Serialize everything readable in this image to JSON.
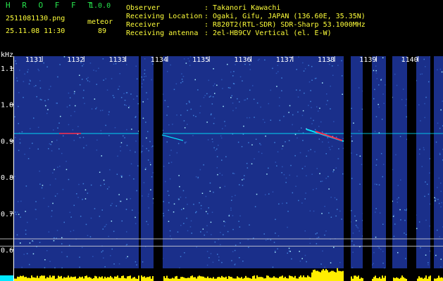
{
  "header": {
    "app_name": "H R O F F T",
    "version": "1.0.0",
    "file_name": "2511081130.png",
    "mode": "meteor",
    "datetime": "25.11.08 11:30",
    "count": "89",
    "fields": [
      {
        "label": "Observer",
        "value": ": Takanori Kawachi"
      },
      {
        "label": "Receiving Location",
        "value": ": Ogaki, Gifu, JAPAN (136.60E, 35.35N)"
      },
      {
        "label": "Receiver",
        "value": ": R820T2(RTL-SDR) SDR-Sharp 53.1000MHz"
      },
      {
        "label": "Receiving antenna",
        "value": ": 2el-HB9CV Vertical (el. E-W)"
      }
    ]
  },
  "chart_data": {
    "type": "heatmap",
    "ylabel": "kHz",
    "y_ticks": [
      "1.1",
      "1.0",
      "0.9",
      "0.8",
      "0.7",
      "0.6"
    ],
    "y_tick_values": [
      1.1,
      1.0,
      0.9,
      0.8,
      0.7,
      0.6
    ],
    "time_labels": [
      "1131",
      "1132",
      "1133",
      "1134",
      "1135",
      "1136",
      "1137",
      "1138",
      "1139",
      "1140"
    ],
    "carrier_khz": 0.92,
    "colors": {
      "background": "#1a2f8a",
      "noise": "#3f7fd9",
      "signal": "#00e8ff",
      "trace": "#ff2a4a",
      "power": "#ffee00",
      "axis": "#ffffff"
    }
  }
}
